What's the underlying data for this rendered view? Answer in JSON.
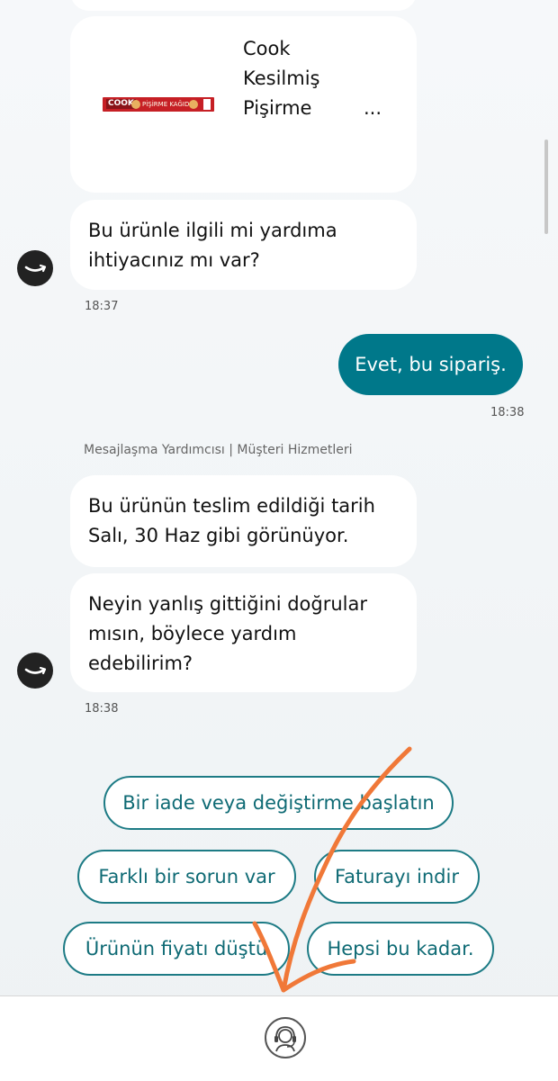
{
  "product_card": {
    "title_lines": [
      "Cook",
      "Kesilmiş",
      "Pişirme"
    ],
    "ellipsis": "...",
    "thumb_brand": "COOK",
    "thumb_text": "PİŞİRME KAĞIDI"
  },
  "messages": [
    {
      "id": "bot1",
      "text_lines": [
        "Bu ürünle ilgili mi yardıma",
        "ihtiyacınız mı var?"
      ]
    },
    {
      "id": "user1",
      "text": "Evet, bu sipariş."
    },
    {
      "id": "bot2",
      "text_lines": [
        "Bu ürünün teslim edildiği tarih",
        "Salı, 30 Haz gibi görünüyor."
      ]
    },
    {
      "id": "bot3",
      "text_lines": [
        "Neyin yanlış gittiğini doğrular",
        "mısın, böylece yardım",
        "edebilirim?"
      ]
    }
  ],
  "timestamps": [
    "18:37",
    "18:38",
    "18:38"
  ],
  "sender_label": "Mesajlaşma Yardımcısı | Müşteri Hizmetleri",
  "quick_replies": [
    "Bir iade veya değiştirme başlatın",
    "Farklı bir sorun var",
    "Faturayı indir",
    "Ürünün fiyatı düştü",
    "Hepsi bu kadar."
  ],
  "colors": {
    "accent": "#00788a",
    "annotation": "#f07838",
    "chip_text": "#0e6a74"
  },
  "icons": {
    "avatar": "amazon-smile-icon",
    "footer": "headset-agent-icon"
  }
}
